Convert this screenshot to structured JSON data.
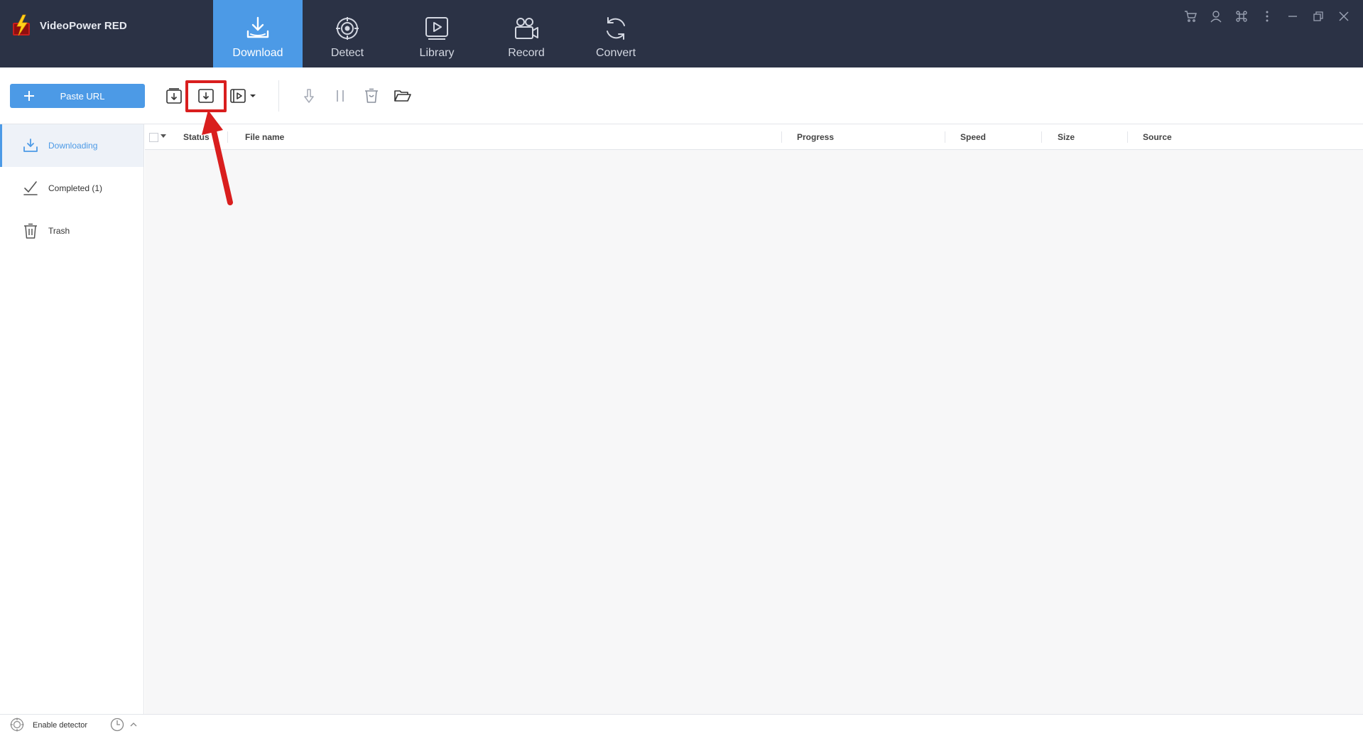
{
  "app": {
    "title": "VideoPower RED"
  },
  "nav_tabs": [
    {
      "label": "Download",
      "icon": "download-icon",
      "active": true
    },
    {
      "label": "Detect",
      "icon": "target-icon",
      "active": false
    },
    {
      "label": "Library",
      "icon": "play-icon",
      "active": false
    },
    {
      "label": "Record",
      "icon": "camera-icon",
      "active": false
    },
    {
      "label": "Convert",
      "icon": "refresh-icon",
      "active": false
    }
  ],
  "toolbar": {
    "paste_url_label": "Paste URL"
  },
  "sidebar": {
    "items": [
      {
        "label": "Downloading",
        "icon": "download-icon",
        "active": true
      },
      {
        "label": "Completed (1)",
        "icon": "check-icon",
        "active": false
      },
      {
        "label": "Trash",
        "icon": "trash-icon",
        "active": false
      }
    ]
  },
  "table": {
    "columns": [
      "Status",
      "File name",
      "Progress",
      "Speed",
      "Size",
      "Source"
    ]
  },
  "statusbar": {
    "enable_detector_label": "Enable detector"
  },
  "colors": {
    "topbar_bg": "#2b3245",
    "accent": "#4c9ae6",
    "highlight": "#d91e1e"
  }
}
